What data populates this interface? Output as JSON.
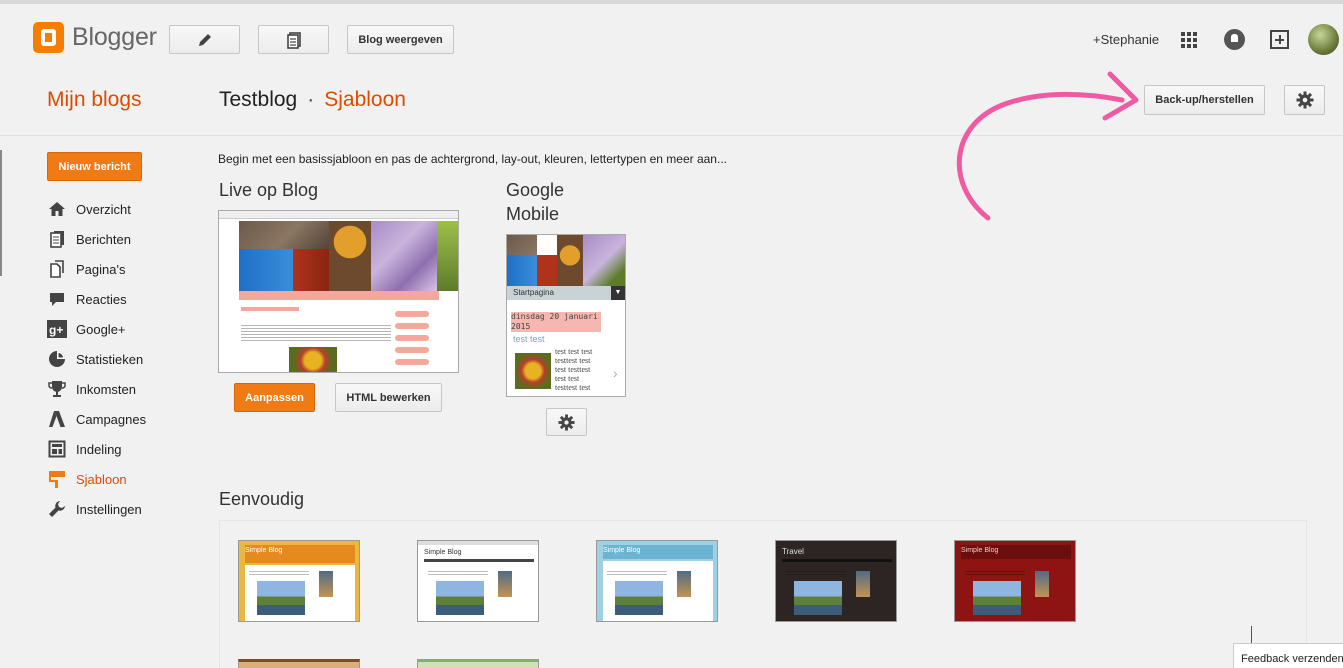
{
  "header": {
    "logo_text": "Blogger",
    "view_blog_label": "Blog weergeven",
    "user_name": "+Stephanie"
  },
  "subheader": {
    "my_blogs": "Mijn blogs",
    "blog_name": "Testblog",
    "separator": "·",
    "current_page": "Sjabloon",
    "backup_label": "Back-up/herstellen"
  },
  "sidebar": {
    "new_post_label": "Nieuw bericht",
    "items": [
      {
        "label": "Overzicht",
        "icon": "home-icon"
      },
      {
        "label": "Berichten",
        "icon": "posts-icon"
      },
      {
        "label": "Pagina's",
        "icon": "pages-icon"
      },
      {
        "label": "Reacties",
        "icon": "comments-icon"
      },
      {
        "label": "Google+",
        "icon": "google-plus-icon"
      },
      {
        "label": "Statistieken",
        "icon": "stats-icon"
      },
      {
        "label": "Inkomsten",
        "icon": "earnings-icon"
      },
      {
        "label": "Campagnes",
        "icon": "campaigns-icon"
      },
      {
        "label": "Indeling",
        "icon": "layout-icon"
      },
      {
        "label": "Sjabloon",
        "icon": "template-icon",
        "active": true
      },
      {
        "label": "Instellingen",
        "icon": "wrench-icon"
      }
    ]
  },
  "main": {
    "intro": "Begin met een basissjabloon en pas de achtergrond, lay-out, kleuren, lettertypen en meer aan...",
    "live_title": "Live op Blog",
    "mobile_title_line1": "Google",
    "mobile_title_line2": "Mobile",
    "customize_label": "Aanpassen",
    "edit_html_label": "HTML bewerken",
    "mobile_thumb": {
      "nav_label": "Startpagina",
      "date": "dinsdag 20 januari 2015",
      "post_title": "test test",
      "post_text": [
        "test test test",
        "testtest test",
        "test testtest",
        "test test",
        "testtest test"
      ]
    },
    "simple_title": "Eenvoudig",
    "templates": [
      {
        "title": "Simple Blog",
        "theme": "orange"
      },
      {
        "title": "Simple Blog",
        "theme": "white"
      },
      {
        "title": "Simple Blog",
        "theme": "blue"
      },
      {
        "title": "Travel",
        "theme": "dark"
      },
      {
        "title": "Simple Blog",
        "theme": "red"
      }
    ]
  },
  "feedback_label": "Feedback verzenden",
  "colors": {
    "accent": "#dd4b00",
    "button_orange": "#f07b15",
    "background": "#f1f1f1",
    "annotation_arrow": "#ef5aa3"
  }
}
